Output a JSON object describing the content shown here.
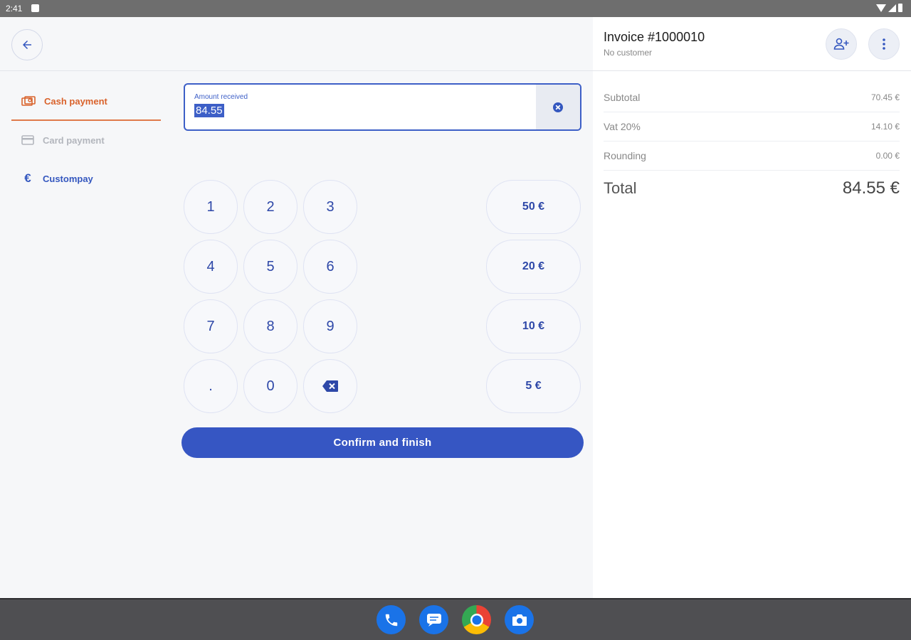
{
  "status_bar": {
    "time": "2:41"
  },
  "navigation": {
    "back_icon": "arrow-left-icon"
  },
  "payment_methods": [
    {
      "label": "Cash payment",
      "icon": "cash-icon",
      "state": "active",
      "color": "#d9622b"
    },
    {
      "label": "Card payment",
      "icon": "card-icon",
      "state": "disabled",
      "color": "#b3b6bd"
    },
    {
      "label": "Custompay",
      "icon": "euro-icon",
      "state": "enabled",
      "color": "#3457bf"
    }
  ],
  "amount": {
    "label": "Amount received",
    "value": "84.55",
    "clear_icon": "clear-circle-icon"
  },
  "keypad": [
    "1",
    "2",
    "3",
    "4",
    "5",
    "6",
    "7",
    "8",
    "9",
    ".",
    "0",
    "backspace"
  ],
  "quick_amounts": [
    "50 €",
    "20 €",
    "10 €",
    "5 €"
  ],
  "confirm": {
    "label": "Confirm and finish"
  },
  "invoice": {
    "title": "Invoice #1000010",
    "customer": "No customer",
    "actions": [
      "add-customer-icon",
      "more-vert-icon"
    ],
    "summary": [
      {
        "label": "Subtotal",
        "value": "70.45 €"
      },
      {
        "label": "Vat 20%",
        "value": "14.10 €"
      },
      {
        "label": "Rounding",
        "value": "0.00 €"
      }
    ],
    "total": {
      "label": "Total",
      "value": "84.55 €"
    }
  },
  "dock": [
    "phone-icon",
    "messages-icon",
    "chrome-icon",
    "camera-icon"
  ],
  "colors": {
    "accent": "#3656c3",
    "active_tab": "#d9622b",
    "key_text": "#2e48a8"
  }
}
